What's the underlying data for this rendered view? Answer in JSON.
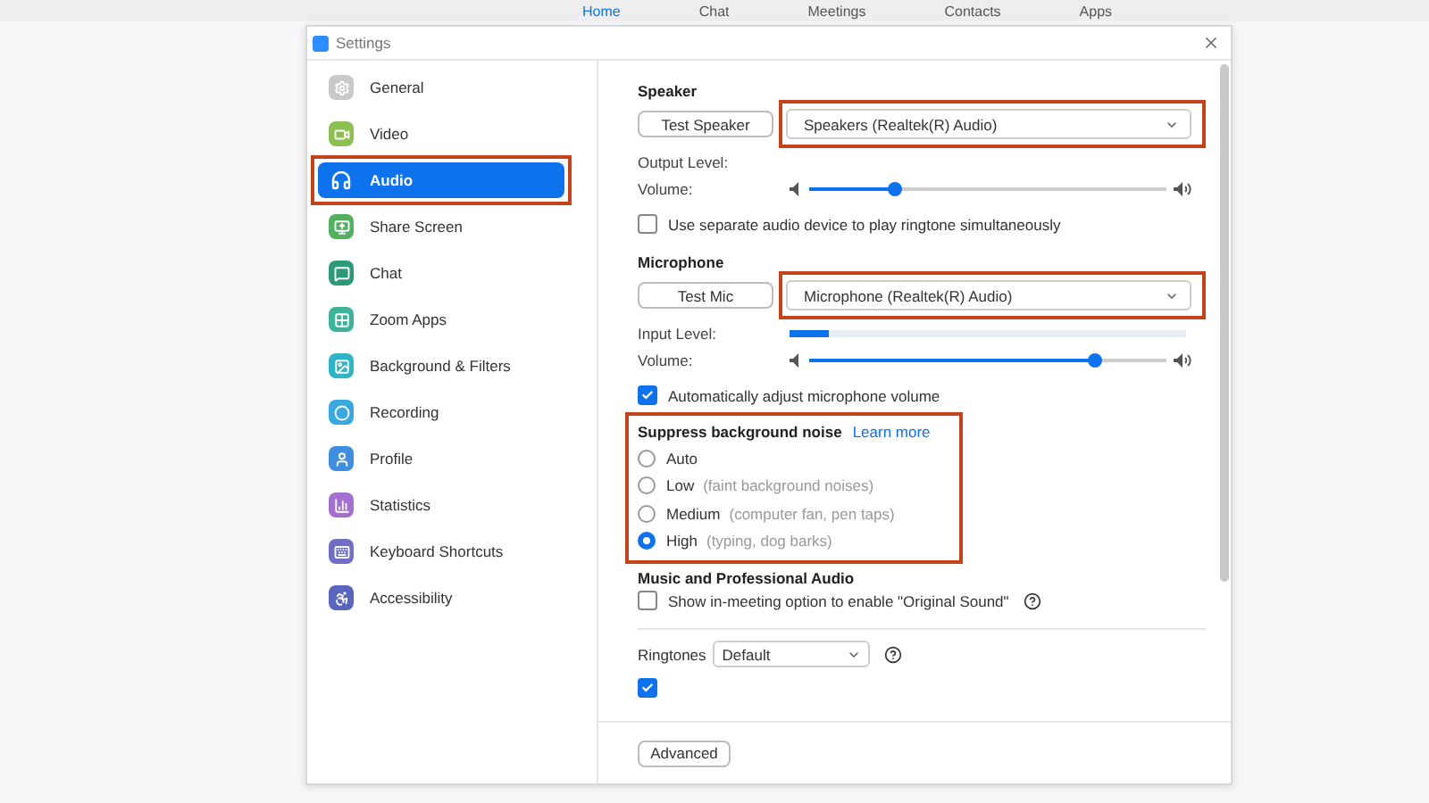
{
  "top_nav": [
    {
      "label": "Home",
      "selected": true
    },
    {
      "label": "Chat",
      "selected": false
    },
    {
      "label": "Meetings",
      "selected": false
    },
    {
      "label": "Contacts",
      "selected": false
    },
    {
      "label": "Apps",
      "selected": false
    }
  ],
  "window": {
    "title": "Settings"
  },
  "sidebar": {
    "items": [
      {
        "label": "General",
        "selected": false,
        "highlighted": false,
        "color": "#c9c9c9"
      },
      {
        "label": "Video",
        "selected": false,
        "highlighted": false,
        "color": "#8cc152"
      },
      {
        "label": "Audio",
        "selected": true,
        "highlighted": true,
        "color": "#0e72ed"
      },
      {
        "label": "Share Screen",
        "selected": false,
        "highlighted": false,
        "color": "#52b060"
      },
      {
        "label": "Chat",
        "selected": false,
        "highlighted": false,
        "color": "#2c9a78"
      },
      {
        "label": "Zoom Apps",
        "selected": false,
        "highlighted": false,
        "color": "#3cb39a"
      },
      {
        "label": "Background & Filters",
        "selected": false,
        "highlighted": false,
        "color": "#2fb5c5"
      },
      {
        "label": "Recording",
        "selected": false,
        "highlighted": false,
        "color": "#3aa8e0"
      },
      {
        "label": "Profile",
        "selected": false,
        "highlighted": false,
        "color": "#3f8ee0"
      },
      {
        "label": "Statistics",
        "selected": false,
        "highlighted": false,
        "color": "#a36fd0"
      },
      {
        "label": "Keyboard Shortcuts",
        "selected": false,
        "highlighted": false,
        "color": "#6f6fc6"
      },
      {
        "label": "Accessibility",
        "selected": false,
        "highlighted": false,
        "color": "#5966bf"
      }
    ]
  },
  "speaker": {
    "heading": "Speaker",
    "test_button": "Test Speaker",
    "device": "Speakers (Realtek(R) Audio)",
    "highlighted": true,
    "output_level": {
      "label": "Output Level:"
    },
    "volume": {
      "label": "Volume:",
      "level": 0.24
    }
  },
  "separate_ringtone": {
    "label": "Use separate audio device to play ringtone simultaneously",
    "checked": false
  },
  "microphone": {
    "heading": "Microphone",
    "test_button": "Test Mic",
    "device": "Microphone (Realtek(R) Audio)",
    "highlighted": true,
    "input_level": {
      "label": "Input Level:",
      "level": 0.1
    },
    "volume": {
      "label": "Volume:",
      "level": 0.8
    }
  },
  "auto_adjust": {
    "label": "Automatically adjust microphone volume",
    "checked": true
  },
  "suppress_noise": {
    "heading": "Suppress background noise",
    "link": "Learn more",
    "highlighted": true,
    "options": [
      {
        "label": "Auto",
        "selected": false
      },
      {
        "label": "Low",
        "hint": "(faint background noises)",
        "selected": false
      },
      {
        "label": "Medium",
        "hint": "(computer fan, pen taps)",
        "selected": false
      },
      {
        "label": "High",
        "hint": "(typing, dog barks)",
        "selected": true
      }
    ]
  },
  "music_audio": {
    "heading": "Music and Professional Audio",
    "original_sound": {
      "label": "Show in-meeting option to enable \"Original Sound\"",
      "checked": false
    }
  },
  "ringtones": {
    "label": "Ringtones",
    "value": "Default"
  },
  "hidden_option": {
    "checked": true
  },
  "footer": {
    "advanced_button": "Advanced"
  }
}
